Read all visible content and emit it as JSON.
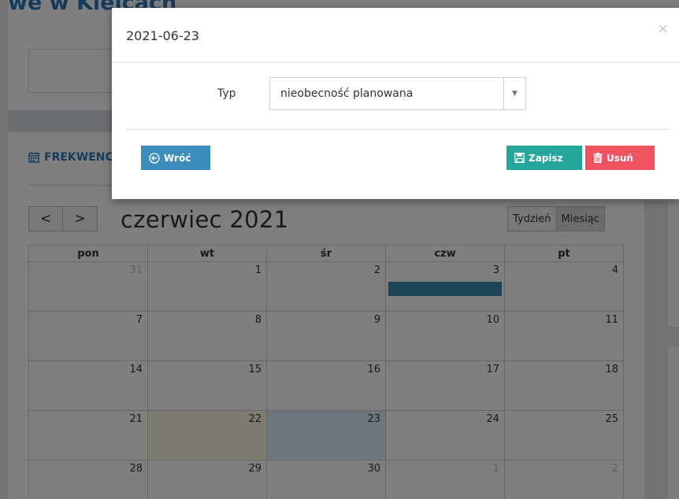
{
  "page": {
    "title": "we w Kielcach",
    "section_label": "FREKWENCJA",
    "calendar": {
      "prev_label": "<",
      "next_label": ">",
      "month_title": "czerwiec 2021",
      "view_week": "Tydzień",
      "view_month": "Miesiąc",
      "weekdays": [
        "pon",
        "wt",
        "śr",
        "czw",
        "pt"
      ],
      "weeks": [
        [
          "31",
          "1",
          "2",
          "3",
          "4"
        ],
        [
          "7",
          "8",
          "9",
          "10",
          "11"
        ],
        [
          "14",
          "15",
          "16",
          "17",
          "18"
        ],
        [
          "21",
          "22",
          "23",
          "24",
          "25"
        ],
        [
          "28",
          "29",
          "30",
          "1",
          "2"
        ]
      ]
    }
  },
  "modal": {
    "title": "2021-06-23",
    "close_label": "×",
    "type_label": "Typ",
    "type_value": "nieobecność planowana",
    "back_label": "Wróć",
    "save_label": "Zapisz",
    "delete_label": "Usuń"
  },
  "colors": {
    "primary": "#3c8dbc",
    "save": "#26a69a",
    "delete": "#ef5360",
    "event": "#3a87ad",
    "today": "#fcf8e3",
    "selected": "#d9edf7"
  },
  "icons": {
    "back": "arrow-circle-left-icon",
    "save": "floppy-disk-icon",
    "delete": "trash-icon",
    "calendar": "calendar-icon"
  }
}
